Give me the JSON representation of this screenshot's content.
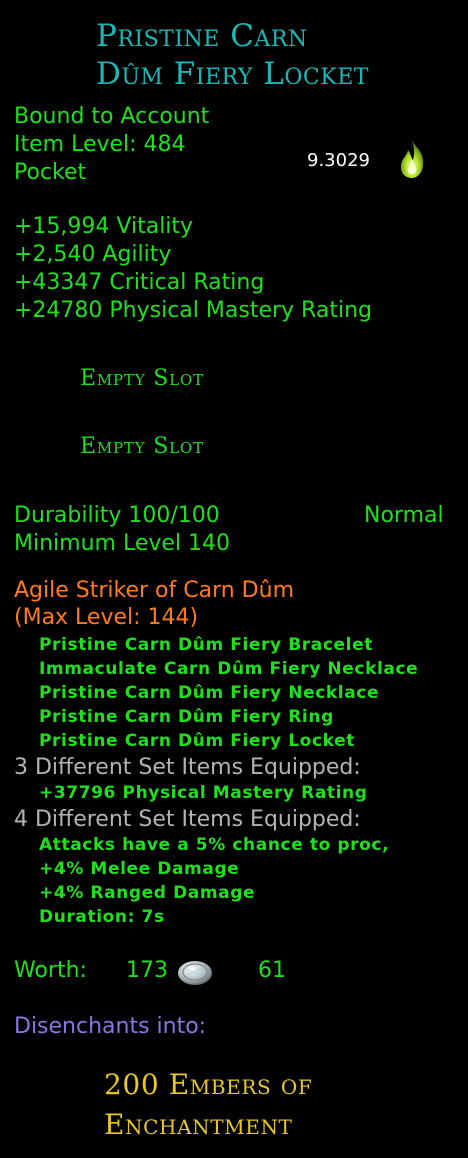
{
  "item": {
    "name_line1": "Pristine Carn",
    "name_line2": "Dûm Fiery Locket",
    "binding": "Bound to Account",
    "item_level": "Item Level: 484",
    "slot_type": "Pocket",
    "dps_value": "9.3029",
    "icon": "flame-icon"
  },
  "stats": [
    "+15,994 Vitality",
    "+2,540 Agility",
    "+43347 Critical Rating",
    "+24780 Physical Mastery Rating"
  ],
  "essence_slots": [
    "Empty Slot",
    "Empty Slot"
  ],
  "durability": {
    "label": "Durability 100/100",
    "type": "Normal"
  },
  "min_level": "Minimum Level 140",
  "set": {
    "name": "Agile Striker of Carn Dûm",
    "max_level": "(Max Level: 144)",
    "items": [
      "Pristine Carn Dûm Fiery Bracelet",
      "Immaculate Carn Dûm Fiery Necklace",
      "Pristine Carn Dûm Fiery Necklace",
      "Pristine Carn Dûm Fiery Ring",
      "Pristine Carn Dûm Fiery Locket"
    ],
    "bonus3_header": "3 Different Set Items Equipped:",
    "bonus3_lines": [
      "+37796 Physical Mastery Rating"
    ],
    "bonus4_header": "4 Different Set Items Equipped:",
    "bonus4_lines": [
      "Attacks have a 5% chance to proc,",
      "+4% Melee Damage",
      "+4% Ranged Damage",
      "Duration: 7s"
    ]
  },
  "worth": {
    "label": "Worth:",
    "silver": "173",
    "copper": "61",
    "icon": "silver-coin-icon"
  },
  "disenchant": {
    "label": "Disenchants into:",
    "result_line1": "200 Embers of",
    "result_line2": "Enchantment"
  }
}
